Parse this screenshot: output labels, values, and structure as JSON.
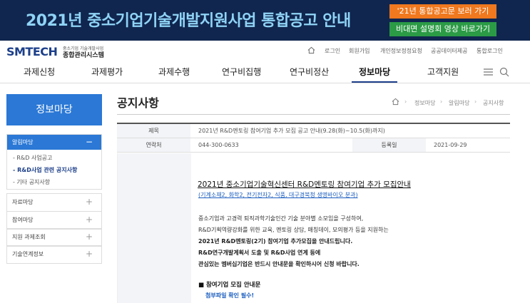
{
  "banner": {
    "title": "2021년 중소기업기술개발지원사업 통합공고 안내",
    "btn_orange": "'21년 통합공고문 보러 가기",
    "btn_green": "비대면 설명회 영상 바로가기"
  },
  "logo": {
    "main": "SMTECH",
    "sub1": "중소기업 기술개발사업",
    "sub2": "종합관리시스템"
  },
  "util_links": [
    "로그인",
    "회원가입",
    "개인정보정정요청",
    "공공데이터제공",
    "통합로그인"
  ],
  "gnb": [
    "과제신청",
    "과제평가",
    "과제수행",
    "연구비집행",
    "연구비정산",
    "정보마당",
    "고객지원"
  ],
  "sidebar": {
    "heading": "정보마당",
    "open_group": "알림마당",
    "open_toggle": "−",
    "sub_items": [
      "- R&D 사업공고",
      "- R&D사업 관련 공지사항",
      "- 기타 공지사항"
    ],
    "groups": [
      "자료마당",
      "참여마당",
      "지원 과제조회",
      "기술연계정보"
    ],
    "toggle": "+"
  },
  "page": {
    "title": "공지사항",
    "breadcrumb": [
      "정보마당",
      "알림마당",
      "공지사항"
    ],
    "crumb_sep": "›"
  },
  "table": {
    "subject_label": "제목",
    "subject": "2021년 R&D멘토링 참여기업 추가 모집 공고 안내(9.28(화)~10.5(화)까지)",
    "contact_label": "연락처",
    "contact": "044-300-0633",
    "date_label": "등록일",
    "date": "2021-09-29"
  },
  "body": {
    "heading": "2021년 중소기업기술혁신센터 R&D멘토링 참여기업 추가 모집안내",
    "fields": "(기계소재2, 화학2, 전기전자2, 식품, 대구경북청 생명바이오 분과)",
    "lines": [
      "중소기업과 고경력 퇴직과학기술인간 기술 분야별 소모임을 구성하여,",
      "R&D기획역량강화를 위한 교육, 멘토링 상담, 매칭데이, 모의평가 등을 지원하는",
      "2021년 R&D멘토링(2기) 참여기업 추가모집을 안내드립니다.",
      "R&D연구개발계획서 도출 및 R&D사업 연계 등에",
      "관심있는 멤버십기업은 반드시 안내문을 확인하시어 신청 바랍니다."
    ],
    "section_title": "■ 참여기업 모집 안내문",
    "attach_note": "첨부파일 확인 필수!"
  }
}
